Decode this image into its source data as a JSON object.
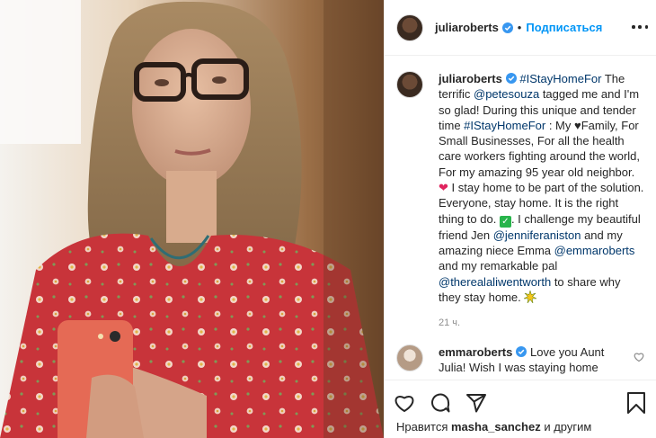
{
  "post": {
    "username": "juliaroberts",
    "separator": "•",
    "follow_label": "Подписаться",
    "caption": {
      "hashtag_1": "#IStayHomeFor",
      "text_1": " The terrific ",
      "mention_1": "@petesouza",
      "text_2": " tagged me and I'm so glad! During this unique and tender time ",
      "hashtag_2": "#IStayHomeFor",
      "text_3": " : My ",
      "heart_black": "♥",
      "text_4": "Family, For Small Businesses, For all the health care workers fighting around the world, For my amazing 95 year old neighbor. ",
      "heart_red": "❤",
      "text_5": " I stay home to be part of the solution. Everyone, stay home. It is the right thing to do. ",
      "check_mark": "✓",
      "text_6": ". I challenge my beautiful friend Jen ",
      "mention_2": "@jenniferaniston",
      "text_7": " and my amazing niece Emma ",
      "mention_3": "@emmaroberts",
      "text_8": " and my remarkable pal ",
      "mention_4": "@therealaliwentworth",
      "text_9": " to share why they stay home. "
    },
    "time_ago": "21 ч.",
    "comments": [
      {
        "username": "emmaroberts",
        "text": " Love you Aunt Julia! Wish I was staying home"
      }
    ],
    "likes": {
      "prefix": "Нравится ",
      "user": "masha_sanchez",
      "suffix": " и другим"
    }
  },
  "icons": {
    "verified": "verified-badge-icon",
    "more": "more-options-icon",
    "like": "heart-icon",
    "comment": "comment-icon",
    "share": "share-icon",
    "save": "bookmark-icon",
    "comment_like": "small-heart-icon"
  },
  "colors": {
    "link_blue": "#0095f6",
    "tag_blue": "#00376b",
    "text": "#262626",
    "muted": "#8e8e8e",
    "border": "#efefef",
    "heart_red": "#e0245e",
    "check_green": "#28b44b"
  }
}
